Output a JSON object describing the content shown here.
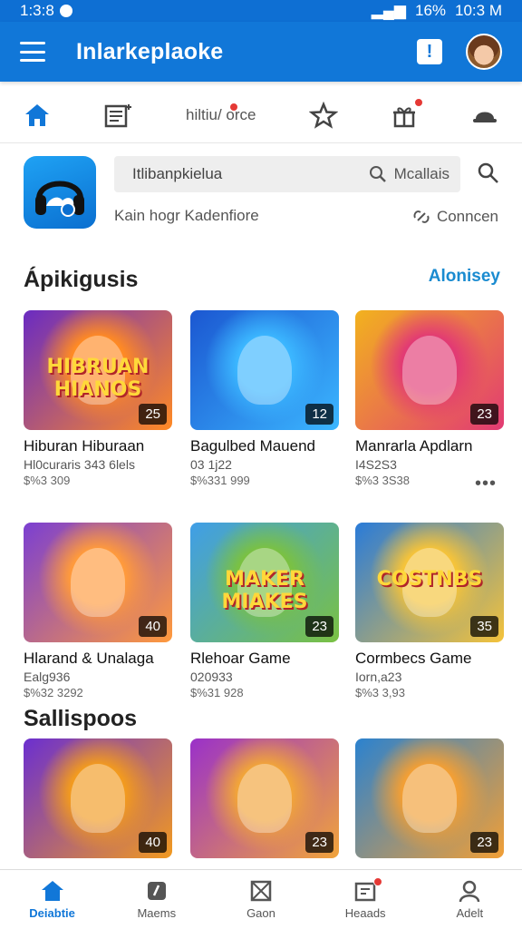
{
  "status_bar": {
    "time_left": "1:3:8",
    "battery": "16%",
    "time_right": "10:3 M"
  },
  "app_bar": {
    "title": "Inlarkeplaoke",
    "notify_label": "!"
  },
  "tabs": [
    {
      "label": "",
      "icon": "home-icon",
      "active": true
    },
    {
      "label": "",
      "icon": "news-icon"
    },
    {
      "label": "hiltiu/ orce",
      "icon": "badge-dot"
    },
    {
      "label": "",
      "icon": "star-icon"
    },
    {
      "label": "",
      "icon": "gift-icon"
    },
    {
      "label": "",
      "icon": "cap-icon"
    }
  ],
  "hero": {
    "search_placeholder": "Itlibanpkielua",
    "search_action": "Mcallais",
    "subtitle": "Kain hogr Kadenfiore",
    "connect_label": "Conncen"
  },
  "sections": [
    {
      "title": "Ápikigusis",
      "link": "Alonisey"
    },
    {
      "title": "Sallispoos"
    }
  ],
  "games": [
    {
      "name": "Hiburan Hiburaan",
      "meta": "Hl0curaris 343 6lels",
      "price": "$%3 309",
      "count": "25",
      "art": "HIBRUAN HIANOS",
      "colors": [
        "#6a2bc2",
        "#ff8a24"
      ]
    },
    {
      "name": "Bagulbed Mauend",
      "meta": "03 1j22",
      "price": "$%331 999",
      "count": "12",
      "art": "",
      "colors": [
        "#1b57d1",
        "#3bb6ff"
      ]
    },
    {
      "name": "Manrarla Apdlarn",
      "meta": "I4S2S3",
      "price": "$%3 3S38",
      "count": "23",
      "art": "",
      "colors": [
        "#f2b21e",
        "#e23a74"
      ]
    },
    {
      "name": "Hlarand & Unalaga",
      "meta": "Ealg936",
      "price": "$%32 3292",
      "count": "40",
      "art": "",
      "colors": [
        "#7b3fd2",
        "#ff9a3c"
      ]
    },
    {
      "name": "Rlehoar Game",
      "meta": "020933",
      "price": "$%31 928",
      "count": "23",
      "art": "MAKER MIAKES",
      "colors": [
        "#3f9ee8",
        "#7ac142"
      ]
    },
    {
      "name": "Cormbecs Game",
      "meta": "Iorn,a23",
      "price": "$%3 3,93",
      "count": "35",
      "art": "COSTNBS",
      "colors": [
        "#2a7bd8",
        "#f5c33a"
      ]
    },
    {
      "name": "",
      "meta": "",
      "price": "",
      "count": "40",
      "art": "",
      "colors": [
        "#6b2fd0",
        "#f29a1f"
      ]
    },
    {
      "name": "",
      "meta": "",
      "price": "",
      "count": "23",
      "art": "",
      "colors": [
        "#9a31c9",
        "#f1a43a"
      ]
    },
    {
      "name": "",
      "meta": "",
      "price": "",
      "count": "23",
      "art": "",
      "colors": [
        "#2b82cf",
        "#f29f35"
      ]
    }
  ],
  "more_label": "•••",
  "bottom_nav": [
    {
      "label": "Deiabtie",
      "icon": "home-icon",
      "active": true
    },
    {
      "label": "Maems",
      "icon": "tag-icon"
    },
    {
      "label": "Gaon",
      "icon": "grid-icon"
    },
    {
      "label": "Heaads",
      "icon": "calendar-icon"
    },
    {
      "label": "Adelt",
      "icon": "person-icon"
    }
  ]
}
